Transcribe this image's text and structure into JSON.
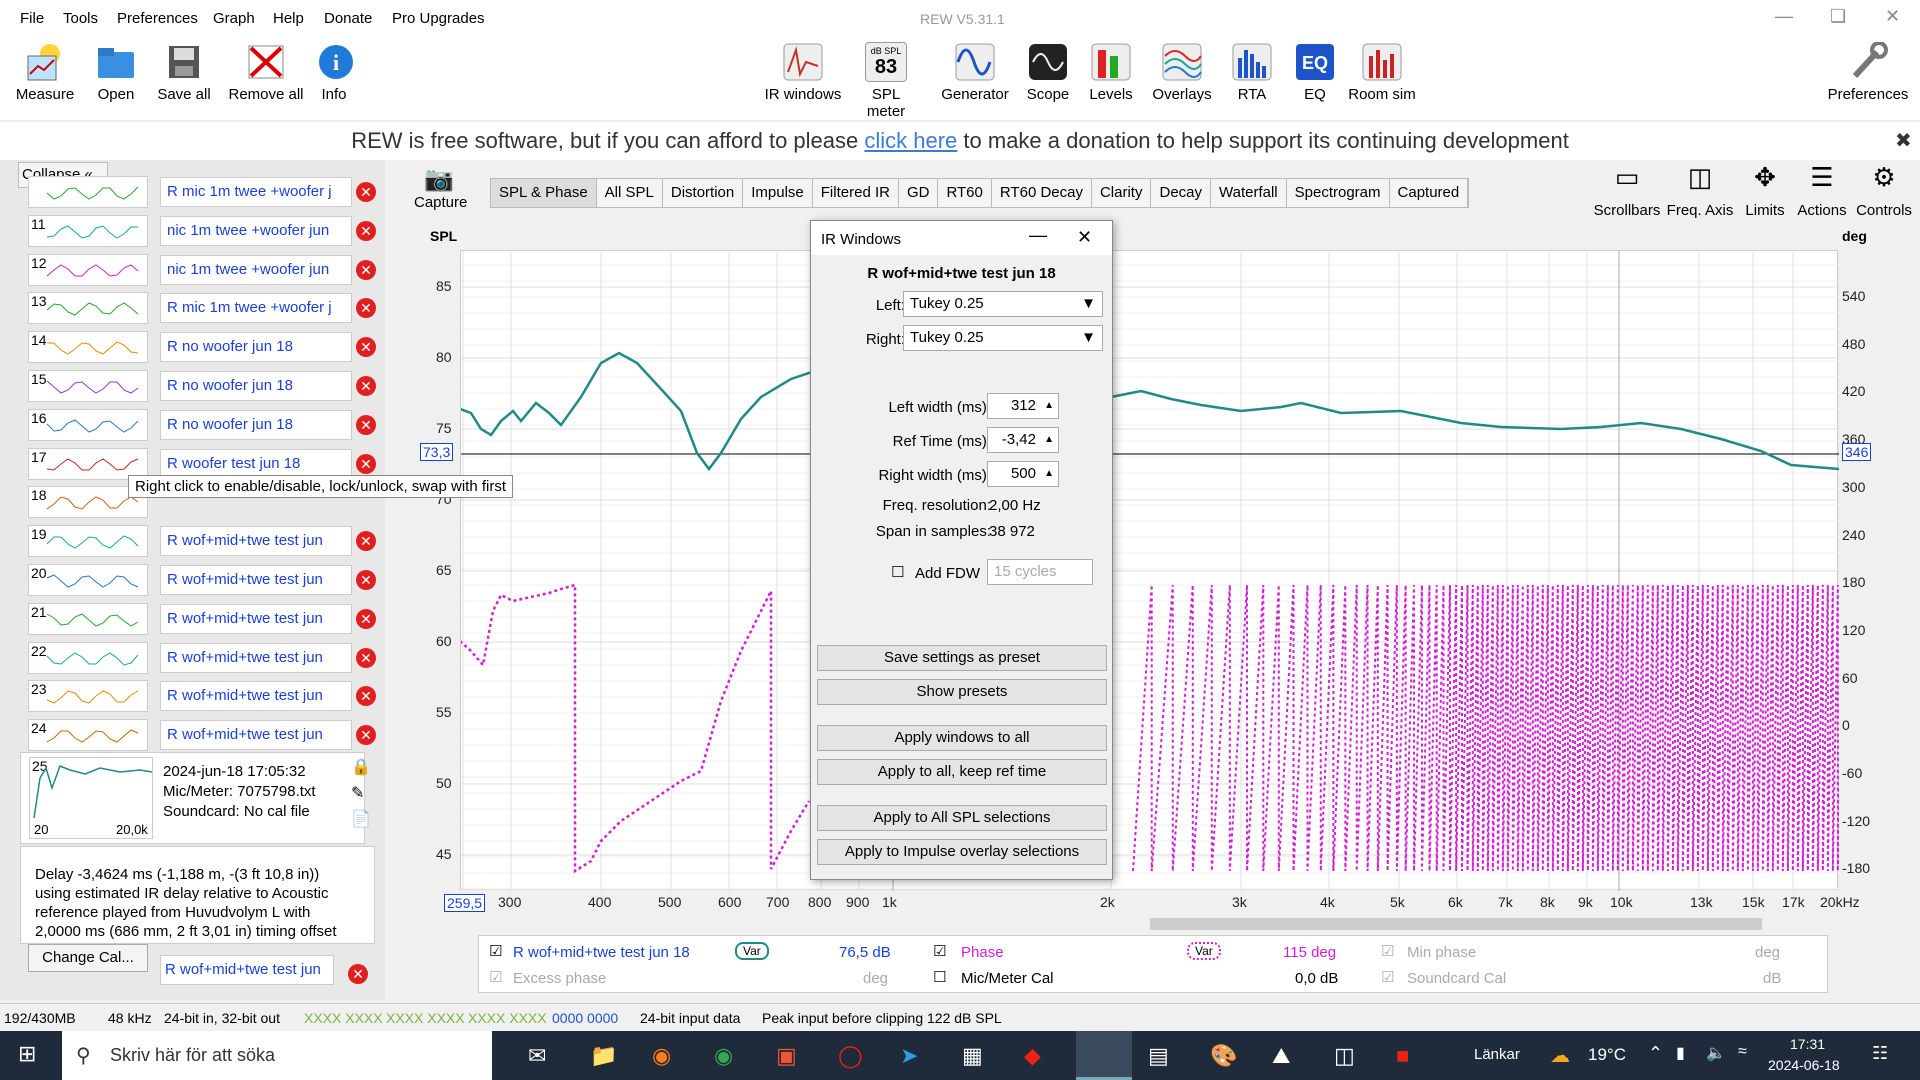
{
  "menu": {
    "items": [
      "File",
      "Tools",
      "Preferences",
      "Graph",
      "Help",
      "Donate",
      "Pro Upgrades"
    ]
  },
  "window": {
    "title": "REW V5.31.1"
  },
  "toolbar": {
    "left": [
      "Measure",
      "Open",
      "Save all",
      "Remove all",
      "Info"
    ],
    "center": [
      "IR windows",
      "SPL meter",
      "Generator",
      "Scope",
      "Levels",
      "Overlays",
      "RTA",
      "EQ",
      "Room sim"
    ],
    "right": "Preferences",
    "spl_meter_top": "dB SPL",
    "spl_meter_value": "83"
  },
  "donate": {
    "before": "REW is free software, but if you can afford to please ",
    "link": "click here",
    "after": " to make a donation to help support its continuing development"
  },
  "panel": {
    "collapse": "Collapse",
    "tooltip": "Right click to enable/disable, lock/unlock, swap with first",
    "change_cal": "Change Cal...",
    "last_item": "R wof+mid+twe test jun",
    "measurements": [
      {
        "num": "",
        "name": "R mic 1m twee +woofer j"
      },
      {
        "num": "11",
        "name": "nic 1m twee +woofer jun"
      },
      {
        "num": "12",
        "name": "nic 1m twee +woofer jun"
      },
      {
        "num": "13",
        "name": "R mic 1m twee +woofer j"
      },
      {
        "num": "14",
        "name": "R no woofer jun 18"
      },
      {
        "num": "15",
        "name": "R no woofer jun 18"
      },
      {
        "num": "16",
        "name": "R no woofer jun 18"
      },
      {
        "num": "17",
        "name": "R woofer test jun 18"
      },
      {
        "num": "18",
        "name": ""
      },
      {
        "num": "19",
        "name": "R wof+mid+twe test jun"
      },
      {
        "num": "20",
        "name": "R wof+mid+twe test jun"
      },
      {
        "num": "21",
        "name": "R wof+mid+twe test jun"
      },
      {
        "num": "22",
        "name": "R wof+mid+twe test jun"
      },
      {
        "num": "23",
        "name": "R wof+mid+twe test jun"
      },
      {
        "num": "24",
        "name": "R wof+mid+twe test jun"
      }
    ],
    "selected": {
      "num": "25",
      "date": "2024-jun-18 17:05:32",
      "mic": "Mic/Meter: 7075798.txt",
      "soundcard": "Soundcard: No cal file",
      "x_min": "20",
      "x_max": "20,0k"
    },
    "notes": "Delay -3,4624 ms (-1,188 m, -(3 ft 10,8 in)) using estimated IR delay relative to Acoustic reference played from Huvudvolym L with 2,0000 ms (686 mm, 2 ft 3,01 in) timing offset"
  },
  "graph": {
    "capture": "Capture",
    "tabs": [
      "SPL & Phase",
      "All SPL",
      "Distortion",
      "Impulse",
      "Filtered IR",
      "GD",
      "RT60",
      "RT60 Decay",
      "Clarity",
      "Decay",
      "Waterfall",
      "Spectrogram",
      "Captured"
    ],
    "active_tab": "SPL & Phase",
    "tools": [
      "Scrollbars",
      "Freq. Axis",
      "Limits",
      "Actions",
      "Controls"
    ],
    "left_axis_title": "SPL",
    "right_axis_title": "deg",
    "y_left": [
      "85",
      "80",
      "75",
      "70",
      "65",
      "60",
      "55",
      "50",
      "45"
    ],
    "y_right": [
      "540",
      "480",
      "420",
      "360",
      "300",
      "240",
      "180",
      "120",
      "60",
      "0",
      "-60",
      "-120",
      "-180"
    ],
    "x_ticks": [
      "259,5",
      "300",
      "400",
      "500",
      "600",
      "700",
      "800",
      "900",
      "1k",
      "2k",
      "3k",
      "4k",
      "5k",
      "6k",
      "7k",
      "8k",
      "9k",
      "10k",
      "13k",
      "15k",
      "17k",
      "20kHz"
    ],
    "cursor_left": "73,3",
    "cursor_right": "346"
  },
  "legend": {
    "meas_name": "R wof+mid+twe test jun 18",
    "var1": "Var",
    "spl_value": "76,5 dB",
    "phase_label": "Phase",
    "var2": "Var",
    "phase_value": "115 deg",
    "min_phase": "Min phase",
    "min_phase_unit": "deg",
    "excess_phase": "Excess phase",
    "excess_unit": "deg",
    "mic_cal": "Mic/Meter Cal",
    "mic_cal_value": "0,0 dB",
    "soundcard_cal": "Soundcard Cal",
    "soundcard_unit": "dB"
  },
  "irwin": {
    "title": "IR Windows",
    "meas": "R wof+mid+twe test jun 18",
    "left_label": "Left:",
    "left_value": "Tukey 0.25",
    "right_label": "Right:",
    "right_value": "Tukey 0.25",
    "lw_label": "Left width (ms):",
    "lw": "312",
    "ref_label": "Ref Time (ms):",
    "ref": "-3,42",
    "rw_label": "Right width (ms):",
    "rw": "500",
    "freq_label": "Freq. resolution:",
    "freq": "2,00 Hz",
    "span_label": "Span in samples:",
    "span": "38 972",
    "fdw_label": "Add FDW",
    "fdw_value": "15 cycles",
    "buttons": [
      "Save settings as preset",
      "Show presets",
      "Apply windows to all",
      "Apply to all, keep ref time",
      "Apply to All SPL selections",
      "Apply to Impulse overlay selections"
    ]
  },
  "status": {
    "mem": "192/430MB",
    "rate": "48 kHz",
    "bits": "24-bit in, 32-bit out",
    "leds1": "XXXX XXXX",
    "leds2": "XXXX XXXX",
    "leds3": "XXXX XXXX",
    "leds4": "0000 0000",
    "input": "24-bit input data",
    "peak": "Peak input before clipping 122 dB SPL"
  },
  "taskbar": {
    "search": "Skriv här för att söka",
    "links": "Länkar",
    "temp": "19°C",
    "time": "17:31",
    "date": "2024-06-18"
  },
  "colors": {
    "spl": "#1f8a86",
    "phase": "#d41ed4",
    "accent": "#1a3fd6"
  }
}
